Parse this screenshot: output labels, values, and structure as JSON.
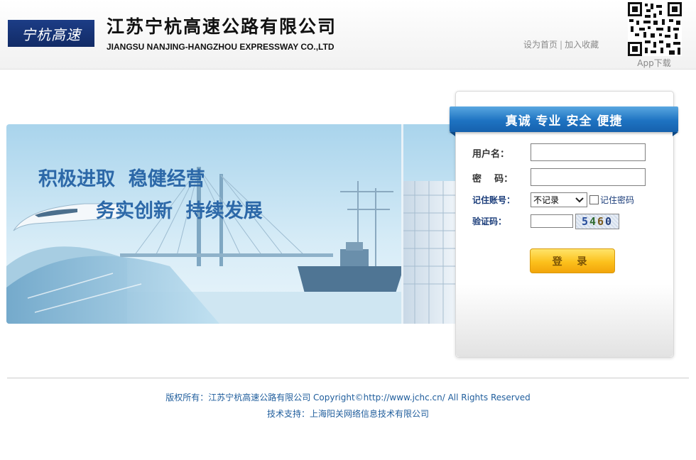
{
  "header": {
    "logo_text": "宁杭高速",
    "company_cn": "江苏宁杭高速公路有限公司",
    "company_en": "JIANGSU NANJING-HANGZHOU EXPRESSWAY CO.,LTD",
    "link_homepage": "设为首页",
    "link_separator": "|",
    "link_favorite": "加入收藏",
    "qr_label": "App下载"
  },
  "banner": {
    "slogan_1": "积极进取  稳健经营",
    "slogan_2": "务实创新  持续发展"
  },
  "login": {
    "ribbon_title": "真诚 专业 安全 便捷",
    "username_label": "用户名：",
    "username_value": "",
    "password_label": "密    码：",
    "password_value": "",
    "remember_label": "记住账号：",
    "remember_selected": "不记录",
    "remember_password_label": "记住密码",
    "captcha_label": "验证码：",
    "captcha_value": "",
    "captcha_code": [
      "5",
      "4",
      "6",
      "0"
    ],
    "login_button": "登 录"
  },
  "footer": {
    "copyright": "版权所有：江苏宁杭高速公路有限公司 Copyright©http://www.jchc.cn/ All Rights Reserved",
    "support": "技术支持：上海阳关网络信息技术有限公司"
  },
  "colors": {
    "brand_blue": "#1c3d86",
    "ribbon_blue": "#1e73c2",
    "button_yellow": "#fcc11c",
    "footer_text": "#1f5d9c"
  }
}
